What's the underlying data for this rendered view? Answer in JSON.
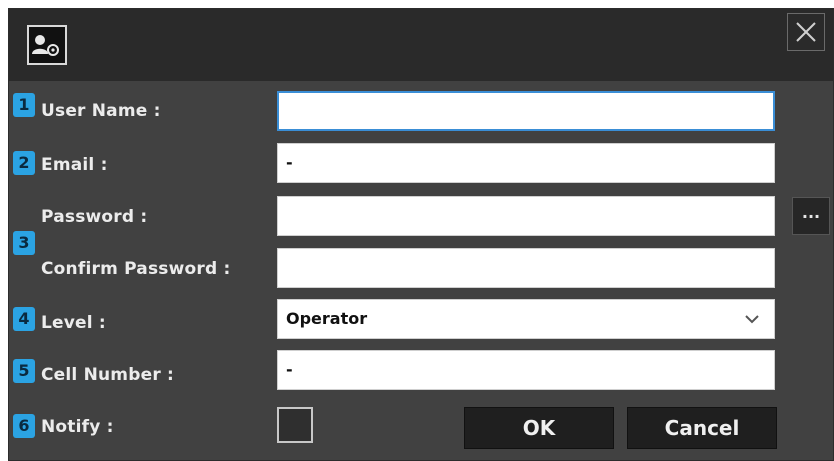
{
  "close_icon": "close-icon",
  "app_icon": "user-settings-icon",
  "badges": {
    "b1": "1",
    "b2": "2",
    "b3": "3",
    "b4": "4",
    "b5": "5",
    "b6": "6"
  },
  "form": {
    "user_name_label": "User Name :",
    "user_name_value": "",
    "email_label": "Email :",
    "email_value": "-",
    "password_label": "Password :",
    "password_value": "",
    "confirm_password_label": "Confirm Password :",
    "confirm_password_value": "",
    "browse_label": "...",
    "level_label": "Level :",
    "level_value": "Operator",
    "cell_number_label": "Cell Number :",
    "cell_number_value": "-",
    "notify_label": "Notify :"
  },
  "buttons": {
    "ok": "OK",
    "cancel": "Cancel"
  },
  "colors": {
    "badge": "#2ba3e3",
    "focus": "#3a8ed6",
    "panel": "#414141",
    "titlebar": "#2a2a2a"
  }
}
